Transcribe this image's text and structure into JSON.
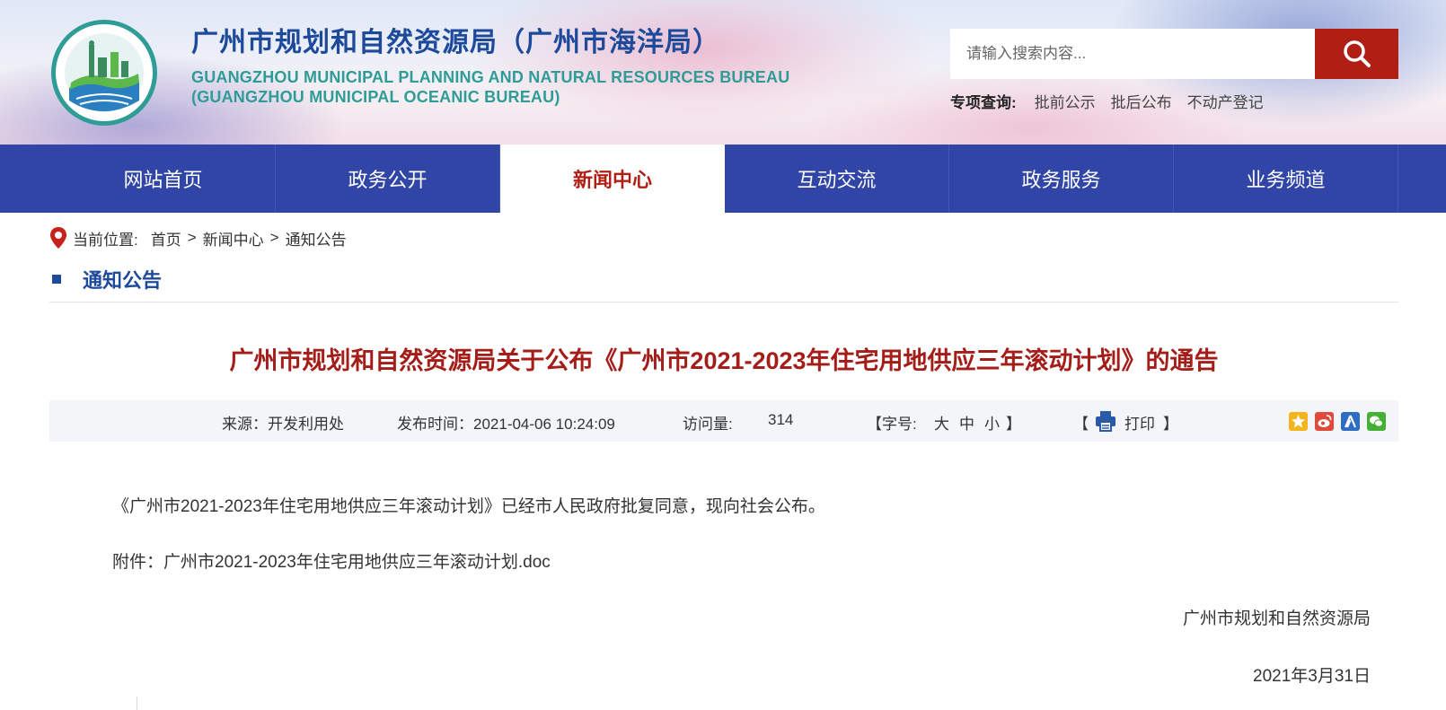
{
  "header": {
    "title_cn": "广州市规划和自然资源局（广州市海洋局）",
    "title_en_line1": "GUANGZHOU MUNICIPAL PLANNING AND NATURAL RESOURCES BUREAU",
    "title_en_line2": "(GUANGZHOU MUNICIPAL OCEANIC BUREAU)",
    "logo_icon": "bureau-emblem-logo",
    "search": {
      "placeholder": "请输入搜索内容...",
      "button_icon": "search-icon"
    },
    "special_query": {
      "label": "专项查询:",
      "links": [
        "批前公示",
        "批后公布",
        "不动产登记"
      ]
    }
  },
  "nav": {
    "items": [
      "网站首页",
      "政务公开",
      "新闻中心",
      "互动交流",
      "政务服务",
      "业务频道"
    ],
    "active": "新闻中心"
  },
  "breadcrumb": {
    "prefix": "当前位置:",
    "items": [
      "首页",
      "新闻中心",
      "通知公告"
    ],
    "separator": ">"
  },
  "section_title": "通知公告",
  "article": {
    "title": "广州市规划和自然资源局关于公布《广州市2021-2023年住宅用地供应三年滚动计划》的通告",
    "meta": {
      "source": "来源：开发利用处",
      "published": "发布时间：2021-04-06 10:24:09",
      "visits_label": "访问量:",
      "visits_value": "314",
      "font_size_open": "【字号:",
      "font_large": "大",
      "font_medium": "中",
      "font_small": "小",
      "font_size_close": "】",
      "print_open": "【",
      "print_label": "打印",
      "print_close": "】",
      "share_icons": [
        "qzone-share-icon",
        "weibo-share-icon",
        "renren-share-icon",
        "wechat-share-icon"
      ]
    },
    "paragraph": "《广州市2021-2023年住宅用地供应三年滚动计划》已经市人民政府批复同意，现向社会公布。",
    "attachment_label": "附件：",
    "attachment_name": "广州市2021-2023年住宅用地供应三年滚动计划.doc",
    "signature": "广州市规划和自然资源局",
    "date": "2021年3月31日"
  },
  "colors": {
    "nav_bg": "#3045a6",
    "active_red": "#b01e14",
    "title_blue": "#1e4a9c",
    "en_teal": "#2f9c98"
  }
}
